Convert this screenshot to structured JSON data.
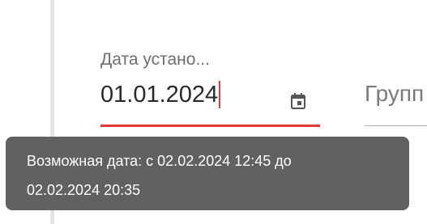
{
  "date_field": {
    "label": "Дата устано...",
    "value": "01.01.2024",
    "icon": "calendar-icon",
    "error_color": "#e53935"
  },
  "group_field": {
    "placeholder": "Групп"
  },
  "tooltip": {
    "line1": "Возможная дата: с 02.02.2024 12:45 до",
    "line2": "02.02.2024 20:35",
    "background": "#616161"
  }
}
